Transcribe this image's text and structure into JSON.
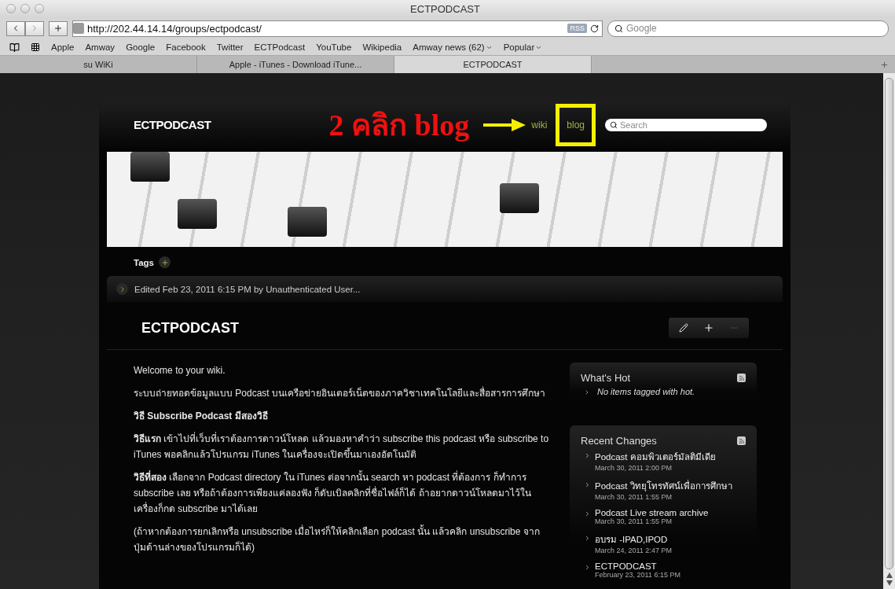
{
  "browser": {
    "title": "ECTPODCAST",
    "url": "http://202.44.14.14/groups/ectpodcast/",
    "rss_label": "RSS",
    "search_placeholder": "Google",
    "bookmarks": [
      {
        "label": "Apple",
        "menu": false
      },
      {
        "label": "Amway",
        "menu": false
      },
      {
        "label": "Google",
        "menu": false
      },
      {
        "label": "Facebook",
        "menu": false
      },
      {
        "label": "Twitter",
        "menu": false
      },
      {
        "label": "ECTPodcast",
        "menu": false
      },
      {
        "label": "YouTube",
        "menu": false
      },
      {
        "label": "Wikipedia",
        "menu": false
      },
      {
        "label": "Amway news (62)",
        "menu": true
      },
      {
        "label": "Popular",
        "menu": true
      }
    ],
    "tabs": [
      {
        "label": "su WiKi",
        "selected": false
      },
      {
        "label": "Apple - iTunes - Download iTune...",
        "selected": false
      },
      {
        "label": "ECTPODCAST",
        "selected": true
      }
    ]
  },
  "site": {
    "name": "ECTPODCAST",
    "annotation": "2 คลิก blog",
    "nav": [
      {
        "label": "wiki",
        "highlighted": false
      },
      {
        "label": "blog",
        "highlighted": true
      }
    ],
    "search_placeholder": "Search",
    "tags_label": "Tags",
    "edited": "Edited Feb 23, 2011 6:15 PM by Unauthenticated User...",
    "page_title": "ECTPODCAST",
    "tools": [
      {
        "kind": "edit",
        "disabled": false
      },
      {
        "kind": "add",
        "disabled": false
      },
      {
        "kind": "remove",
        "disabled": true
      }
    ],
    "paragraphs": [
      {
        "text": "Welcome to your wiki.",
        "bold": false
      },
      {
        "text": "ระบบถ่ายทอดข้อมูลแบบ Podcast บนเครือข่ายอินเตอร์เน็ตของภาควิชาเทคโนโลยีและสื่อสารการศึกษา",
        "bold": false
      },
      {
        "text": "วิธี Subscribe Podcast มีสองวิธี",
        "bold": true
      },
      {
        "text": "**วิธีแรก** เข้าไปที่เว็บที่เราต้องการดาวน์โหลด แล้วมองหาคำว่า subscribe this podcast หรือ subscribe to iTunes พอคลิกแล้วโปรแกรม iTunes ในเครื่องจะเปิดขึ้นมาเองอัตโนมัติ",
        "bold": false
      },
      {
        "text": "**วิธีที่สอง** เลือกจาก Podcast directory ใน iTunes ต่อจากนั้น search หา podcast ที่ต้องการ ก็ทำการ subscribe เลย หรือถ้าต้องการเพียงแค่ลองฟัง ก็ดับเบิลคลิกที่ชื่อไฟล์ก็ได้ ถ้าอยากดาวน์โหลดมาไว้ในเครื่องก็กด subscribe มาได้เลย",
        "bold": false
      },
      {
        "text": "(ถ้าหากต้องการยกเลิกหรือ unsubscribe เมื่อไหร่ก็ให้คลิกเลือก podcast นั้น แล้วคลิก unsubscribe จากปุ่มด้านล่างของโปรแกรมก็ได้)",
        "bold": false
      }
    ],
    "widgets": [
      {
        "title": "What's Hot",
        "empty": "No items tagged with hot."
      },
      {
        "title": "Recent Changes",
        "items": [
          {
            "title": "Podcast คอมพิวเตอร์มัลติมีเดีย",
            "date": "March 30, 2011 2:00 PM"
          },
          {
            "title": "Podcast วิทยุโทรทัศน์เพื่อการศึกษา",
            "date": "March 30, 2011 1:55 PM"
          },
          {
            "title": "Podcast Live stream archive",
            "date": "March 30, 2011 1:55 PM"
          },
          {
            "title": "อบรม -IPAD,IPOD",
            "date": "March 24, 2011 2:47 PM"
          },
          {
            "title": "ECTPODCAST",
            "date": "February 23, 2011 6:15 PM"
          }
        ]
      }
    ]
  }
}
